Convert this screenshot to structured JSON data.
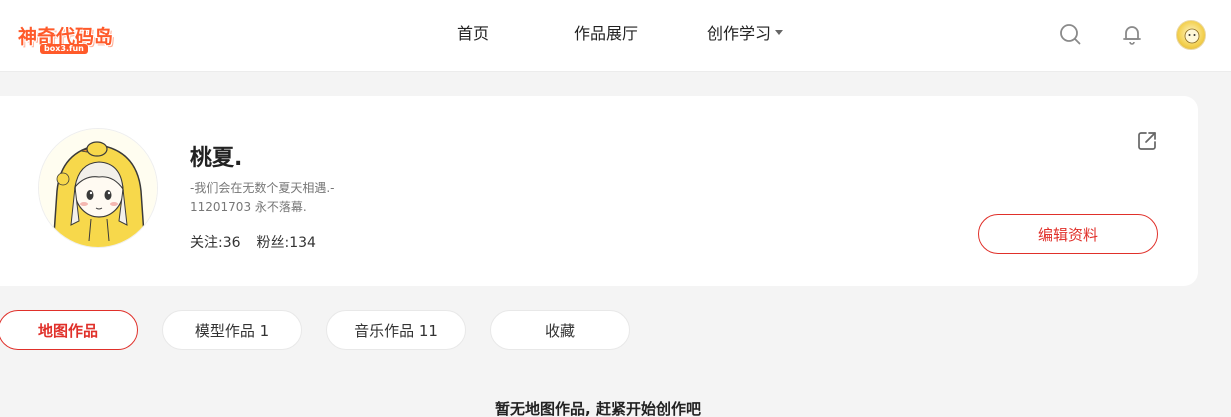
{
  "header": {
    "logo_text": "神奇代码岛",
    "logo_sub": "box3.fun",
    "nav": {
      "home": "首页",
      "gallery": "作品展厅",
      "learn": "创作学习"
    },
    "icons": [
      "search-icon",
      "bell-icon",
      "user-avatar"
    ]
  },
  "profile": {
    "username": "桃夏.",
    "bio_line1": "-我们会在无数个夏天相遇.-",
    "bio_line2": "11201703 永不落幕.",
    "following_label": "关注:36",
    "followers_label": "粉丝:134",
    "edit_label": "编辑资料"
  },
  "tabs": {
    "map": "地图作品",
    "model": "模型作品 1",
    "music": "音乐作品 11",
    "favorites": "收藏"
  },
  "empty_message": "暂无地图作品, 赶紧开始创作吧",
  "colors": {
    "accent": "#e0302a",
    "logo": "#ff5a2a",
    "background": "#f4f4f4"
  }
}
